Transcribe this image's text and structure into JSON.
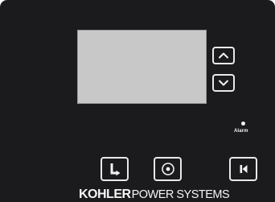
{
  "colors": {
    "panel": "#1b1b1d",
    "display": "#c8c8c8",
    "key_border": "#e9e9e9",
    "text": "#f5f5f5"
  },
  "display": {
    "text": ""
  },
  "buttons": {
    "up": {
      "icon": "chevron-up-icon"
    },
    "down": {
      "icon": "chevron-down-icon"
    },
    "return": {
      "icon": "return-arrow-icon"
    },
    "select": {
      "icon": "select-circle-icon"
    },
    "home": {
      "icon": "home-icon"
    }
  },
  "alarm": {
    "label": "Alarm"
  },
  "brand": {
    "bold": "KOHLER",
    "light": "POWER SYSTEMS"
  }
}
